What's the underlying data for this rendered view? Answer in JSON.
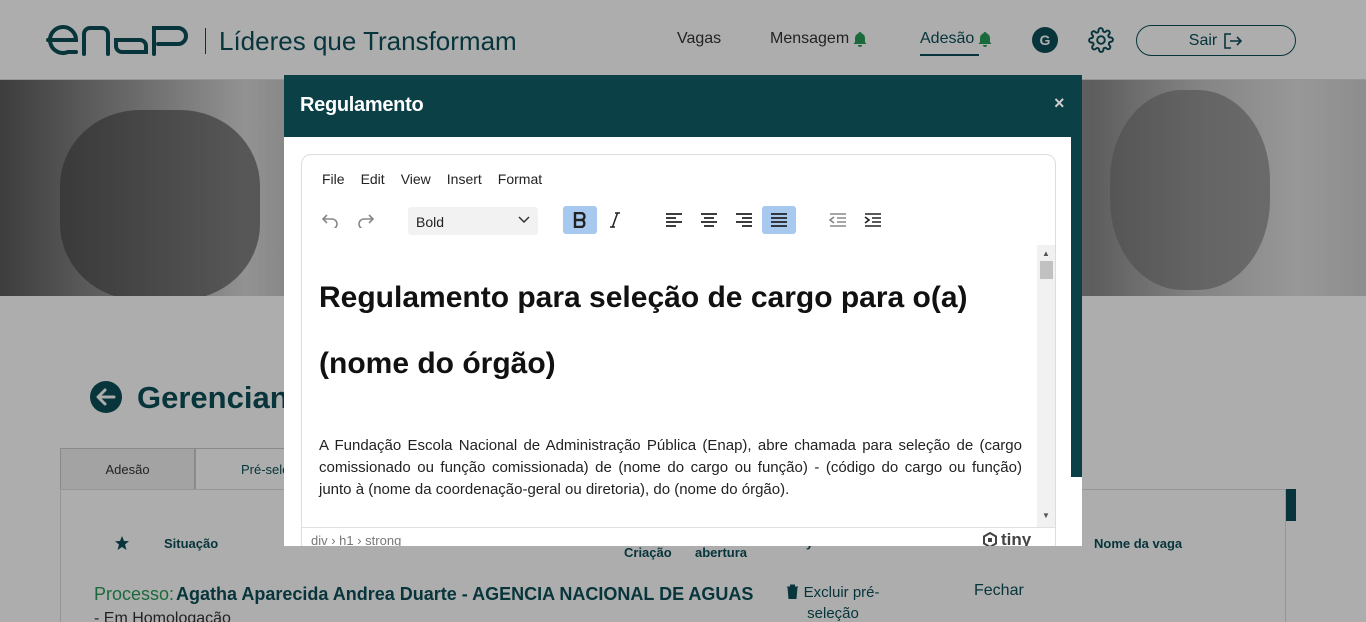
{
  "header": {
    "site_title": "Líderes que Transformam",
    "nav": {
      "vagas": "Vagas",
      "mensagem": "Mensagem",
      "adesao": "Adesão"
    },
    "avatar_initial": "G",
    "sair_label": "Sair"
  },
  "main": {
    "page_title": "Gerencian",
    "tabs": [
      {
        "label": "Adesão"
      },
      {
        "label": "Pré-sele"
      }
    ],
    "table_headers": {
      "situacao": "Situação",
      "criacao": "Criação",
      "abertura": "abertura",
      "nome_vaga": "Nome da vaga",
      "partial": "y"
    },
    "row": {
      "process_label": "Processo:",
      "process_name": "Agatha Aparecida Andrea Duarte - AGENCIA NACIONAL DE AGUAS",
      "status": "- Em Homologação",
      "excluir_label": "Excluir pré-seleção",
      "fechar_label": "Fechar"
    }
  },
  "modal": {
    "title": "Regulamento",
    "close": "×",
    "editor": {
      "menu": [
        "File",
        "Edit",
        "View",
        "Insert",
        "Format"
      ],
      "block_format": "Bold",
      "content_heading": "Regulamento para seleção de cargo para o(a) (nome do órgão)",
      "content_paragraph": "A Fundação Escola Nacional de Administração Pública (Enap), abre chamada para seleção de (cargo comissionado ou função comissionada) de (nome do cargo ou função) - (código do cargo ou função) junto à (nome da coordenação-geral ou diretoria), do (nome do órgão).",
      "element_path": "div › h1 › strong",
      "brand": "tiny"
    }
  },
  "colors": {
    "primary": "#0b4f57",
    "modal_header": "#0b4046",
    "active_button": "#a7c9ef",
    "process_label": "#2a9c57"
  }
}
